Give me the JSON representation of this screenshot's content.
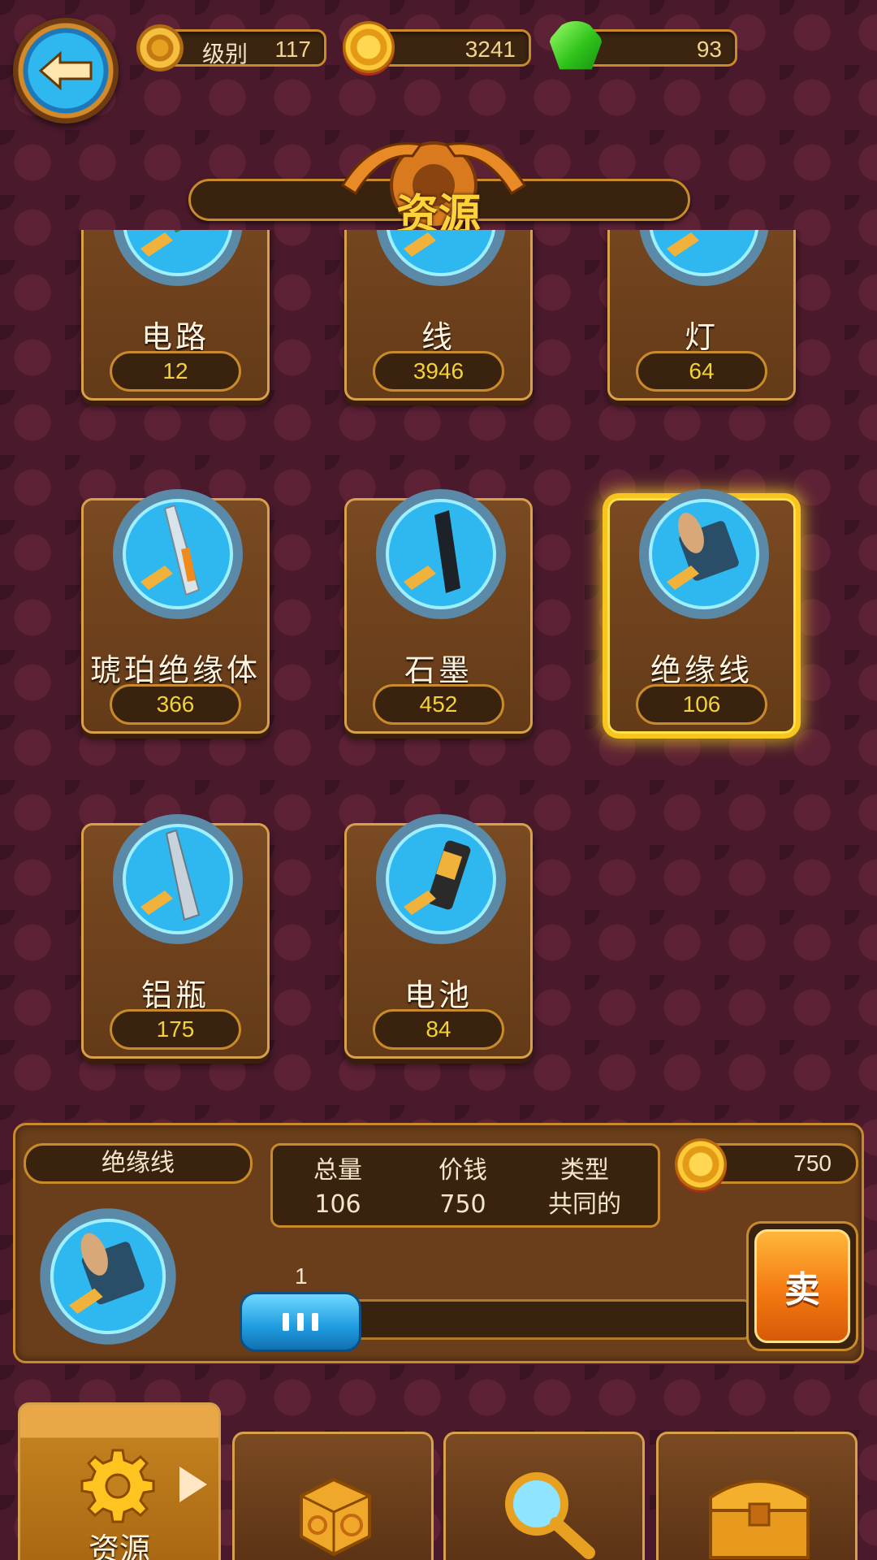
{
  "header": {
    "level_label": "级别",
    "level_value": "117",
    "coins": "3241",
    "gems": "93"
  },
  "title": "资源",
  "items": [
    {
      "name": "电路",
      "count": "12",
      "icon": "circuit-board-icon"
    },
    {
      "name": "线",
      "count": "3946",
      "icon": "wire-spool-icon"
    },
    {
      "name": "灯",
      "count": "64",
      "icon": "lamp-icon"
    },
    {
      "name": "琥珀绝缘体",
      "count": "366",
      "icon": "amber-bottle-icon"
    },
    {
      "name": "石墨",
      "count": "452",
      "icon": "graphite-rod-icon"
    },
    {
      "name": "绝缘线",
      "count": "106",
      "icon": "insulated-wire-spool-icon"
    },
    {
      "name": "铝瓶",
      "count": "175",
      "icon": "aluminum-bottle-icon"
    },
    {
      "name": "电池",
      "count": "84",
      "icon": "battery-icon"
    }
  ],
  "detail": {
    "selected_name": "绝缘线",
    "total_label": "总量",
    "total_value": "106",
    "price_label": "价钱",
    "price_value": "750",
    "type_label": "类型",
    "type_value": "共同的",
    "sell_price": "750",
    "quantity": "1",
    "quantity_fraction": 0.01,
    "sell_label": "卖"
  },
  "nav": {
    "active_label": "资源",
    "tabs": [
      "gear-icon",
      "dice-cube-icon",
      "magnifier-icon",
      "treasure-chest-icon"
    ]
  },
  "colors": {
    "background": "#4a1a2c",
    "panel": "#6a3e1a",
    "accent_gold": "#ffd23a",
    "badge_blue": "#2fb8f0",
    "selected_glow": "#f7c51e",
    "sell_orange": "#f47a12"
  }
}
